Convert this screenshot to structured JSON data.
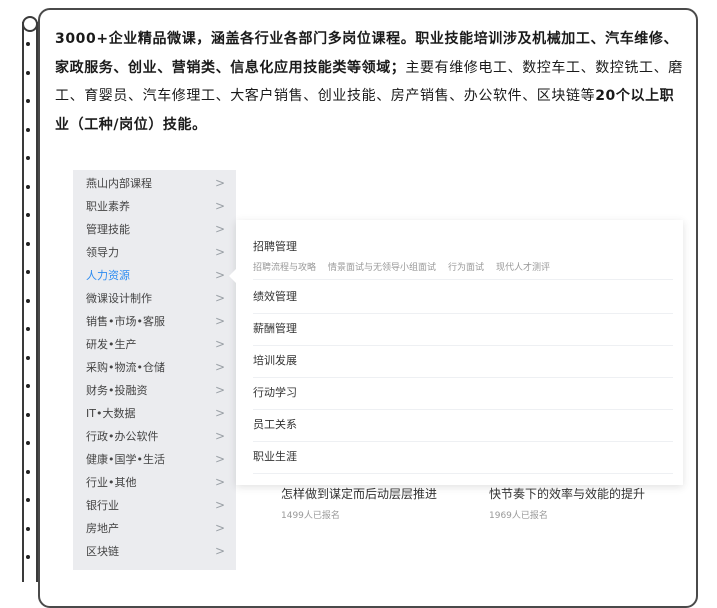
{
  "intro": {
    "bold": "3000+企业精品微课，涵盖各行业各部门多岗位课程。职业技能培训涉及机械加工、汽车维修、家政服务、创业、营销类、信息化应用技能类等领域；",
    "normal": "主要有维修电工、数控车工、数控铣工、磨工、育婴员、汽车修理工、大客户销售、创业技能、房产销售、办公软件、区块链等",
    "bold_tail": "20个以上职业（工种/岗位）技能。"
  },
  "categories": [
    {
      "label": "燕山内部课程",
      "active": false
    },
    {
      "label": "职业素养",
      "active": false
    },
    {
      "label": "管理技能",
      "active": false
    },
    {
      "label": "领导力",
      "active": false
    },
    {
      "label": "人力资源",
      "active": true
    },
    {
      "label": "微课设计制作",
      "active": false
    },
    {
      "label": "销售•市场•客服",
      "active": false
    },
    {
      "label": "研发•生产",
      "active": false
    },
    {
      "label": "采购•物流•仓储",
      "active": false
    },
    {
      "label": "财务•投融资",
      "active": false
    },
    {
      "label": "IT•大数据",
      "active": false
    },
    {
      "label": "行政•办公软件",
      "active": false
    },
    {
      "label": "健康•国学•生活",
      "active": false
    },
    {
      "label": "行业•其他",
      "active": false
    },
    {
      "label": "银行业",
      "active": false
    },
    {
      "label": "房地产",
      "active": false
    },
    {
      "label": "区块链",
      "active": false
    }
  ],
  "chevron": ">",
  "flyout": {
    "groups": [
      {
        "title": "招聘管理",
        "subs": [
          "招聘流程与攻略",
          "情景面试与无领导小组面试",
          "行为面试",
          "现代人才测评"
        ]
      },
      {
        "title": "绩效管理",
        "subs": []
      },
      {
        "title": "薪酬管理",
        "subs": []
      },
      {
        "title": "培训发展",
        "subs": []
      },
      {
        "title": "行动学习",
        "subs": []
      },
      {
        "title": "员工关系",
        "subs": []
      },
      {
        "title": "职业生涯",
        "subs": []
      }
    ]
  },
  "courses": [
    {
      "title": "怎样做到谋定而后动层层推进",
      "signups": "1499人已报名"
    },
    {
      "title": "快节奏下的效率与效能的提升",
      "signups": "1969人已报名"
    }
  ]
}
